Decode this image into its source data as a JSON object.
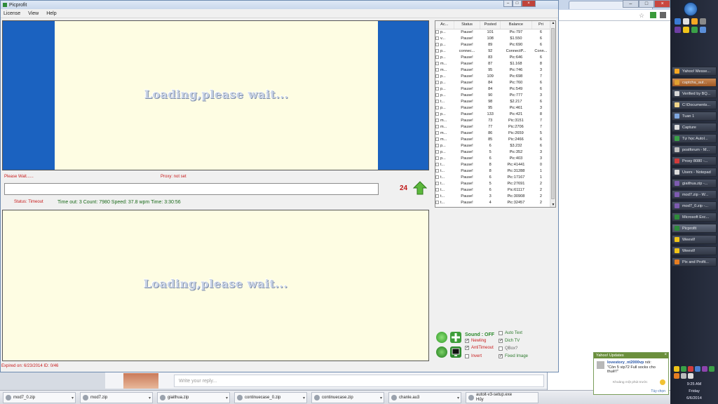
{
  "app": {
    "title": "Picprofit",
    "menu": [
      "License",
      "View",
      "Help"
    ],
    "captcha_loading_top": "Loading,please wait...",
    "captcha_loading_bottom": "Loading,please wait...",
    "please_wait": "Please Wait......",
    "proxy": "Proxy: not set",
    "status_left": "Status: Timeout",
    "stats": "Time out: 3   Count: 7980 Speed: 37.8 wpm  Time: 3:30:56",
    "counter": "24",
    "expired": "Expired on: 6/23/2014   ID: 0/46",
    "sound": "Sound : OFF",
    "options": {
      "newling": "Newling",
      "antitimeout": "AntiTimeout",
      "invert": "Invert",
      "auto_text": "Auto Text",
      "dich_tv": "Dich TV",
      "qbox": "QBox?",
      "fixed_image": "Fixed Image"
    }
  },
  "table": {
    "headers": [
      "Ac...",
      "Status",
      "Posted",
      "Balance",
      "Pri"
    ],
    "rows": [
      [
        "p...",
        "Pause!",
        "101",
        "Pic:797",
        "6"
      ],
      [
        "v...",
        "Pause!",
        "108",
        "$1.550",
        "6"
      ],
      [
        "p...",
        "Pause!",
        "89",
        "Pic:690",
        "6"
      ],
      [
        "p...",
        "connec...",
        "92",
        "ConnectP...",
        "Conn..."
      ],
      [
        "p...",
        "Pause!",
        "83",
        "Pic:646",
        "6"
      ],
      [
        "m...",
        "Pause!",
        "87",
        "$1.168",
        "8"
      ],
      [
        "m...",
        "Pause!",
        "95",
        "Pic:746",
        "3"
      ],
      [
        "p...",
        "Pause!",
        "109",
        "Pic:698",
        "7"
      ],
      [
        "p...",
        "Pause!",
        "84",
        "Pic:760",
        "6"
      ],
      [
        "p...",
        "Pause!",
        "84",
        "Pic:549",
        "6"
      ],
      [
        "p...",
        "Pause!",
        "90",
        "Pic:777",
        "3"
      ],
      [
        "t...",
        "Pause!",
        "98",
        "$2.217",
        "6"
      ],
      [
        "p...",
        "Pause!",
        "95",
        "Pic:461",
        "3"
      ],
      [
        "p...",
        "Pause!",
        "133",
        "Pic:421",
        "8"
      ],
      [
        "m...",
        "Pause!",
        "73",
        "Pic:3151",
        "7"
      ],
      [
        "m...",
        "Pause!",
        "77",
        "Pic:2706",
        "7"
      ],
      [
        "m...",
        "Pause!",
        "86",
        "Pic:2659",
        "5"
      ],
      [
        "m...",
        "Pause!",
        "85",
        "Pic:2466",
        "6"
      ],
      [
        "p...",
        "Pause!",
        "6",
        "$3.232",
        "6"
      ],
      [
        "p...",
        "Pause!",
        "5",
        "Pic:352",
        "3"
      ],
      [
        "p...",
        "Pause!",
        "6",
        "Pic:403",
        "3"
      ],
      [
        "t...",
        "Pause!",
        "8",
        "Pic:41441",
        "0"
      ],
      [
        "t...",
        "Pause!",
        "8",
        "Pic:31288",
        "1"
      ],
      [
        "t...",
        "Pause!",
        "6",
        "Pic:17167",
        "1"
      ],
      [
        "t...",
        "Pause!",
        "5",
        "Pic:27691",
        "2"
      ],
      [
        "t...",
        "Pause!",
        "6",
        "Pic:61117",
        "2"
      ],
      [
        "t...",
        "Pause!",
        "3",
        "Pic:30908",
        "2"
      ],
      [
        "t...",
        "Pause!",
        "4",
        "Pic:32457",
        "2"
      ]
    ]
  },
  "browser": {
    "reply_placeholder": "Write your reply..."
  },
  "vtaskbar": {
    "items": [
      "Yahoo! Messe...",
      "captcha_aut...",
      "Verified by BQ...",
      "C:\\Documents...",
      "Tuan 1",
      "Capture",
      "Tự học AutoI...",
      "postforum - M...",
      "Proxy 8080 -...",
      "Users - Notepad",
      "giaithua.zip -...",
      "mod7.zip - W...",
      "mod7_0.zip -...",
      "Microsoft Exc...",
      "Picprofit",
      "Weevil!",
      "Weevil!",
      "Pix and Profit..."
    ],
    "time": "9:25 AM",
    "day": "Friday",
    "date": "6/6/2014"
  },
  "btaskbar": {
    "items": [
      "mod7_0.zip",
      "mod7.zip",
      "giaithua.zip",
      "continuecase_0.zip",
      "continuecase.zip",
      "chanle.au3",
      "autoit-v3-setup.exe"
    ],
    "last_sub": "Hủy"
  },
  "yahoo": {
    "header": "Yahoo! Updates",
    "user": "lovestory_nt2000vp",
    "said": "nói:",
    "message": "\"Còn 5 vip72 Full socks cho thuê!!\"",
    "sub": "Khoảng một phút trước",
    "option": "Tùy chọn"
  }
}
